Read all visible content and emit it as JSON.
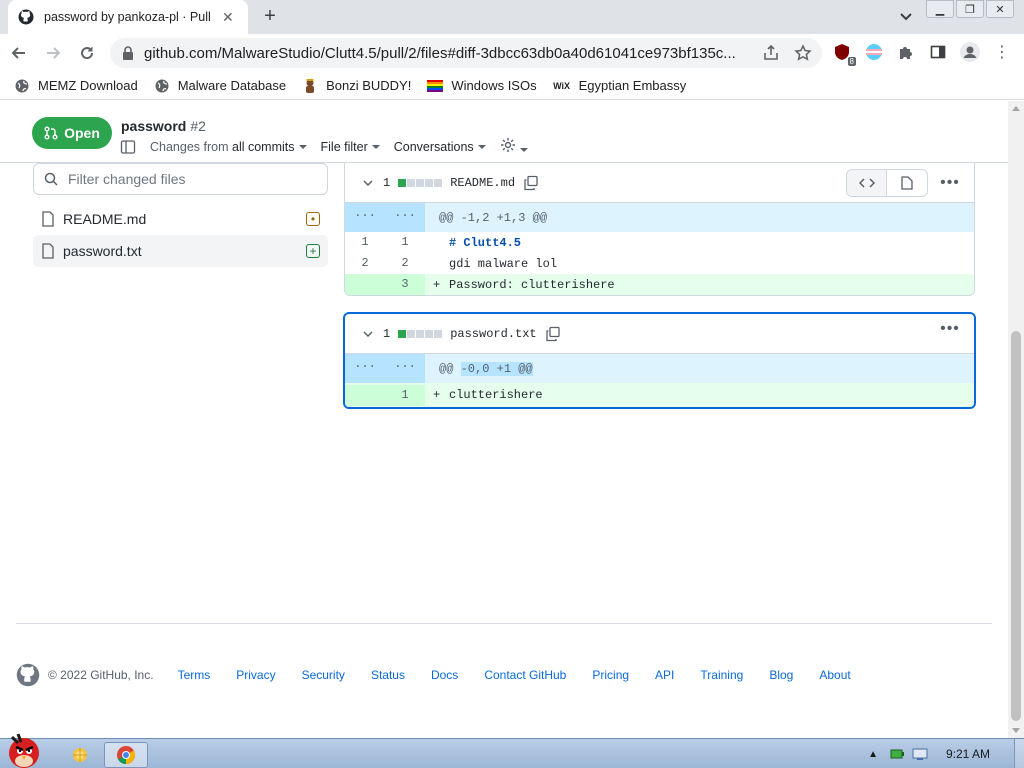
{
  "browser": {
    "tab_title": "password by pankoza-pl · Pull",
    "url": "github.com/MalwareStudio/Clutt4.5/pull/2/files#diff-3dbcc63db0a40d61041ce973bf135c...",
    "extension_badge": "8",
    "bookmarks": [
      {
        "label": "MEMZ Download",
        "icon": "globe-icon"
      },
      {
        "label": "Malware Database",
        "icon": "globe-icon"
      },
      {
        "label": "Bonzi BUDDY!",
        "icon": "bonzi-icon"
      },
      {
        "label": "Windows ISOs",
        "icon": "rainbow-flag-icon"
      },
      {
        "label": "Egyptian Embassy",
        "icon": "wix-icon"
      }
    ]
  },
  "pr": {
    "state": "Open",
    "title": "password",
    "number": "#2",
    "changes_prefix": "Changes from",
    "changes_value": "all commits",
    "file_filter": "File filter",
    "conversations": "Conversations"
  },
  "sidebar": {
    "filter_placeholder": "Filter changed files",
    "files": [
      {
        "name": "README.md",
        "status": "modified"
      },
      {
        "name": "password.txt",
        "status": "added"
      }
    ]
  },
  "diffs": [
    {
      "count": "1",
      "filename": "README.md",
      "hunk": "@@ -1,2 +1,3 @@",
      "lines": [
        {
          "old": "1",
          "new": "1",
          "marker": "",
          "text": "# Clutt4.5"
        },
        {
          "old": "2",
          "new": "2",
          "marker": "",
          "text": "gdi malware lol"
        },
        {
          "old": "",
          "new": "3",
          "marker": "+",
          "text": "Password: clutterishere"
        }
      ]
    },
    {
      "count": "1",
      "filename": "password.txt",
      "hunk_prefix": "@@ ",
      "hunk_selected": "-0,0 +1 @@",
      "lines": [
        {
          "old": "",
          "new": "1",
          "marker": "+",
          "text": "clutterishere"
        }
      ]
    }
  ],
  "hunk_dots": "...",
  "footer": {
    "copyright": "© 2022 GitHub, Inc.",
    "links": [
      "Terms",
      "Privacy",
      "Security",
      "Status",
      "Docs",
      "Contact GitHub",
      "Pricing",
      "API",
      "Training",
      "Blog",
      "About"
    ]
  },
  "taskbar": {
    "clock": "9:21 AM"
  },
  "colors": {
    "open_green": "#2da44e",
    "link_blue": "#0969da",
    "addition_bg": "#e6ffec",
    "hunk_bg": "#ddf4ff"
  }
}
